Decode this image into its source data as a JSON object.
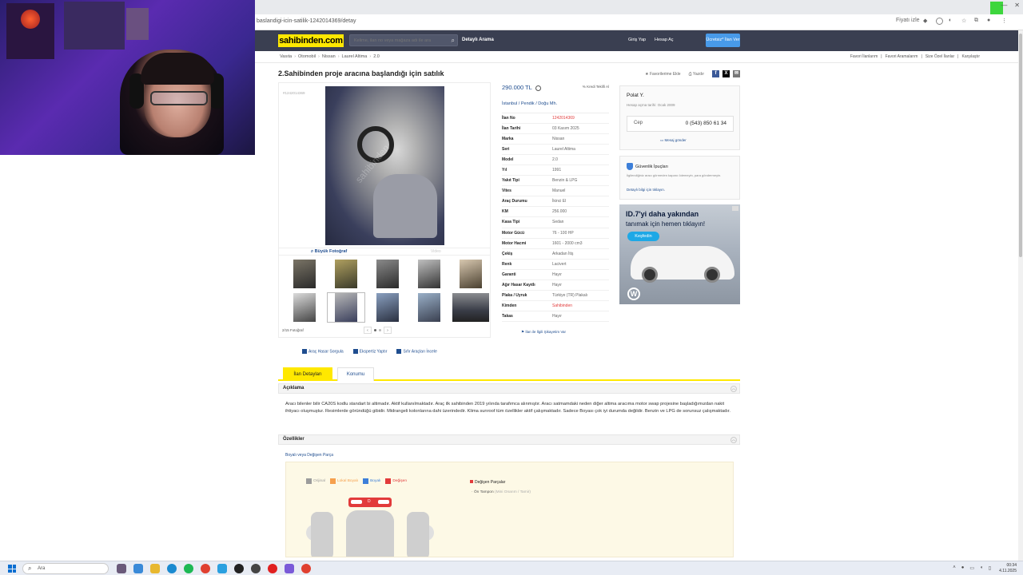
{
  "browser": {
    "url": "baslandigi-icin-satilik-1242014369/detay",
    "price_tag_label": "Fiyatı izle"
  },
  "site": {
    "logo": "sahibinden.com",
    "search_placeholder": "Kelime, ilan no veya mağaza adı ile ara",
    "detailed_search": "Detaylı Arama",
    "login": "Giriş Yap",
    "register": "Hesap Aç",
    "post_ad": "Ücretsiz* İlan Ver"
  },
  "breadcrumb": [
    "Vasıta",
    "Otomobil",
    "Nissan",
    "Laurel Altima",
    "2.0"
  ],
  "fav_links": [
    "Favori İlanlarım",
    "Favori Aramalarım",
    "Size Özel İlanlar",
    "Karşılaştır"
  ],
  "listing": {
    "title": "2.Sahibinden proje aracına başlandığı için satılık",
    "actions": {
      "favorite": "Favorilerime Ekle",
      "print": "Yazdır"
    },
    "id_small": "#1242014369",
    "big_photo": "Büyük Fotoğraf",
    "video": "Video",
    "photo_count": "2/15 Fotoğraf",
    "price": "290.000 TL",
    "offer": "Kredi Teklifi Al",
    "location": "İstanbul  /  Pendik  /  Doğu Mh.",
    "specs": [
      {
        "k": "İlan No",
        "v": "1242014369",
        "red": true
      },
      {
        "k": "İlan Tarihi",
        "v": "03 Kasım 2025"
      },
      {
        "k": "Marka",
        "v": "Nissan"
      },
      {
        "k": "Seri",
        "v": "Laurel Altima"
      },
      {
        "k": "Model",
        "v": "2.0"
      },
      {
        "k": "Yıl",
        "v": "1991"
      },
      {
        "k": "Yakıt Tipi",
        "v": "Benzin & LPG"
      },
      {
        "k": "Vites",
        "v": "Manuel"
      },
      {
        "k": "Araç Durumu",
        "v": "İkinci El"
      },
      {
        "k": "KM",
        "v": "256.000"
      },
      {
        "k": "Kasa Tipi",
        "v": "Sedan"
      },
      {
        "k": "Motor Gücü",
        "v": "76 - 100 HP"
      },
      {
        "k": "Motor Hacmi",
        "v": "1601 - 2000 cm3"
      },
      {
        "k": "Çekiş",
        "v": "Arkadan İtiş"
      },
      {
        "k": "Renk",
        "v": "Lacivert"
      },
      {
        "k": "Garanti",
        "v": "Hayır"
      },
      {
        "k": "Ağır Hasar Kayıtlı",
        "v": "Hayır"
      },
      {
        "k": "Plaka / Uyruk",
        "v": "Türkiye (TR) Plakalı"
      },
      {
        "k": "Kimden",
        "v": "Sahibinden",
        "red": true
      },
      {
        "k": "Takas",
        "v": "Hayır"
      }
    ],
    "report": "İlan ile İlgili Şikayetim Var"
  },
  "seller": {
    "name": "Polat Y.",
    "since": "Hesap açma tarihi: Ocak 2009",
    "phone_label": "Cep",
    "phone": "0 (543) 850 61 34",
    "message": "Mesaj gönder"
  },
  "safety": {
    "title": "Güvenlik İpuçları",
    "text": "İlgilendiğiniz aracı görmeden kaparo ödemeyin, para göndermeyin.",
    "link": "Detaylı bilgi için tıklayın."
  },
  "ad": {
    "title": "ID.7'yi daha yakından",
    "sub": "tanımak için hemen tıklayın!",
    "btn": "Keşfedin",
    "brand": "VW"
  },
  "tools": [
    "Araç Hasar Sorgula",
    "Ekspertiz Yaptır",
    "Sıfır Araçları İncele"
  ],
  "tabs": [
    "İlan Detayları",
    "Konumu"
  ],
  "sections": {
    "aciklama": "Açıklama",
    "description": "Aracı bilenler bilir CA20S kodlu standart bi altimadır. Aktif kullanılmaktadır. Araç ilk sahibinden 2019 yılında tarafımca alınmıştır. Aracı satmamdaki neden diğer altima aracıma motor swap projesine başladığımızdan nakit ihtiyacı oluşmuştur. Resimlerde göründüğü gibidir. Midrangeli kolonlarına dahi üzerindedir. Klima sunroof tüm özellikler aktif çalışmaktadır. Sadece Boyası çok iyi durumda değildir. Benzin ve LPG de sorunsuz çalışmaktadır.",
    "ozellikler": "Özellikler",
    "boya_label": "Boyalı veya Değişen Parça"
  },
  "paint_legend": [
    {
      "label": "Orijinal",
      "color": "#9c9c9c"
    },
    {
      "label": "Lokal Boyalı",
      "color": "#f6a04d"
    },
    {
      "label": "Boyalı",
      "color": "#3d7fd9"
    },
    {
      "label": "Değişen",
      "color": "#e23b3b"
    }
  ],
  "changed": {
    "title": "Değişen Parçalar",
    "item": "Ön Tampon",
    "note": "(Mini Onarım / Tamir)",
    "part_badge": "D"
  },
  "taskbar": {
    "search": "Ara",
    "time": "00:34",
    "date": "4.11.2025"
  }
}
